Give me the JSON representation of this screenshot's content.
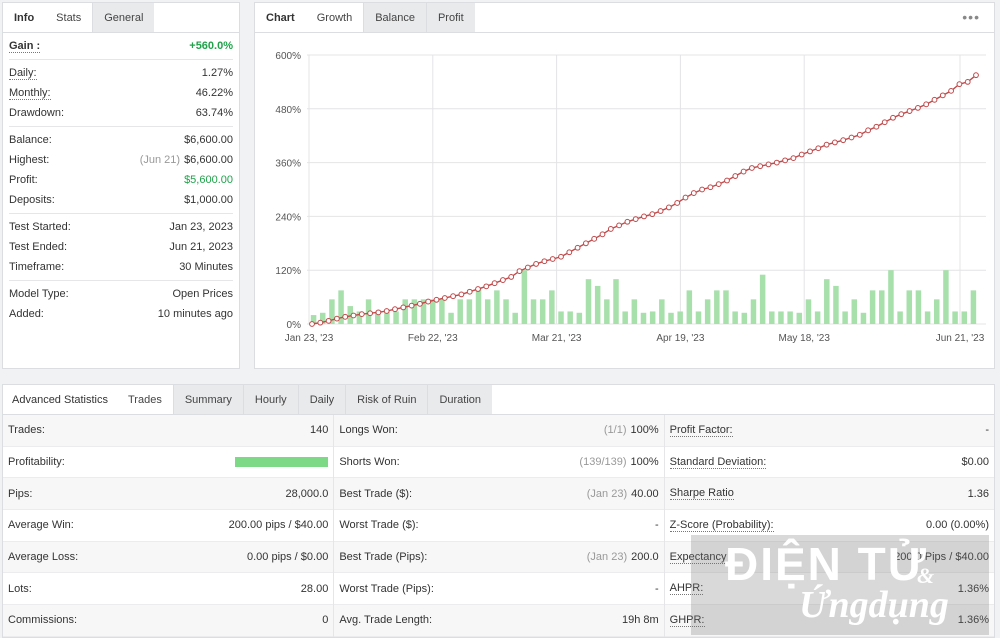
{
  "info": {
    "tabs": [
      "Info",
      "Stats",
      "General"
    ],
    "gain": {
      "label": "Gain :",
      "value": "+560.0%"
    },
    "daily": {
      "label": "Daily:",
      "value": "1.27%"
    },
    "monthly": {
      "label": "Monthly:",
      "value": "46.22%"
    },
    "drawdown": {
      "label": "Drawdown:",
      "value": "63.74%"
    },
    "balance": {
      "label": "Balance:",
      "value": "$6,600.00"
    },
    "highest": {
      "label": "Highest:",
      "date": "(Jun 21)",
      "value": "$6,600.00"
    },
    "profit": {
      "label": "Profit:",
      "value": "$5,600.00"
    },
    "deposits": {
      "label": "Deposits:",
      "value": "$1,000.00"
    },
    "test_started": {
      "label": "Test Started:",
      "value": "Jan 23, 2023"
    },
    "test_ended": {
      "label": "Test Ended:",
      "value": "Jun 21, 2023"
    },
    "timeframe": {
      "label": "Timeframe:",
      "value": "30 Minutes"
    },
    "model_type": {
      "label": "Model Type:",
      "value": "Open Prices"
    },
    "added": {
      "label": "Added:",
      "value": "10 minutes ago"
    }
  },
  "chart_panel": {
    "tabs": [
      "Chart",
      "Growth",
      "Balance",
      "Profit"
    ],
    "menu_icon": "more-dots-icon",
    "menu_glyph": "•••"
  },
  "chart_data": {
    "type": "line",
    "y_ticks": [
      "600%",
      "480%",
      "360%",
      "240%",
      "120%",
      "0%"
    ],
    "y_range": [
      0,
      600
    ],
    "x_tick_labels": [
      "Jan 23, '23",
      "Feb 22, '23",
      "Mar 21, '23",
      "Apr 19, '23",
      "May 18, '23",
      "Jun 21, '23"
    ],
    "grid": true,
    "line_color": "#c0494a",
    "bar_color": "#a8e0ac",
    "growth": [
      0,
      3,
      7,
      12,
      16,
      19,
      22,
      24,
      26,
      29,
      33,
      37,
      41,
      45,
      50,
      54,
      58,
      62,
      66,
      72,
      78,
      84,
      91,
      98,
      105,
      118,
      126,
      134,
      140,
      145,
      150,
      160,
      170,
      180,
      190,
      200,
      212,
      220,
      228,
      234,
      240,
      245,
      252,
      260,
      270,
      282,
      292,
      300,
      305,
      312,
      320,
      330,
      340,
      348,
      352,
      356,
      360,
      365,
      370,
      378,
      385,
      392,
      400,
      405,
      410,
      416,
      422,
      432,
      440,
      450,
      460,
      468,
      475,
      482,
      490,
      500,
      510,
      520,
      535,
      540,
      555
    ],
    "bars": [
      20,
      25,
      55,
      75,
      40,
      28,
      55,
      28,
      28,
      28,
      55,
      55,
      55,
      55,
      55,
      25,
      55,
      55,
      80,
      55,
      75,
      55,
      25,
      120,
      55,
      55,
      75,
      28,
      28,
      25,
      100,
      85,
      55,
      100,
      28,
      55,
      25,
      28,
      55,
      25,
      28,
      75,
      28,
      55,
      75,
      75,
      28,
      25,
      55,
      110,
      28,
      28,
      28,
      25,
      55,
      28,
      100,
      85,
      28,
      55,
      25,
      75,
      75,
      120,
      28,
      75,
      75,
      28,
      55,
      120,
      28,
      28,
      75
    ]
  },
  "advanced": {
    "tabs": [
      "Advanced Statistics",
      "Trades",
      "Summary",
      "Hourly",
      "Daily",
      "Risk of Ruin",
      "Duration"
    ],
    "col1": [
      {
        "label": "Trades:",
        "value": "140"
      },
      {
        "label": "Profitability:",
        "value": ""
      },
      {
        "label": "Pips:",
        "value": "28,000.0"
      },
      {
        "label": "Average Win:",
        "value": "200.00 pips / $40.00"
      },
      {
        "label": "Average Loss:",
        "value": "0.00 pips / $0.00"
      },
      {
        "label": "Lots:",
        "value": "28.00"
      },
      {
        "label": "Commissions:",
        "value": "0"
      }
    ],
    "profitability_pct": 100,
    "col2": [
      {
        "label": "Longs Won:",
        "muted": "(1/1)",
        "value": "100%"
      },
      {
        "label": "Shorts Won:",
        "muted": "(139/139)",
        "value": "100%"
      },
      {
        "label": "Best Trade ($):",
        "muted": "(Jan 23)",
        "value": "40.00"
      },
      {
        "label": "Worst Trade ($):",
        "muted": "",
        "value": "-"
      },
      {
        "label": "Best Trade (Pips):",
        "muted": "(Jan 23)",
        "value": "200.0"
      },
      {
        "label": "Worst Trade (Pips):",
        "muted": "",
        "value": "-"
      },
      {
        "label": "Avg. Trade Length:",
        "muted": "",
        "value": "19h 8m"
      }
    ],
    "col3": [
      {
        "label": "Profit Factor:",
        "value": "-"
      },
      {
        "label": "Standard Deviation:",
        "value": "$0.00"
      },
      {
        "label": "Sharpe Ratio",
        "value": "1.36"
      },
      {
        "label": "Z-Score (Probability):",
        "value": "0.00 (0.00%)"
      },
      {
        "label": "Expectancy",
        "value": "200.0 Pips / $40.00"
      },
      {
        "label": "AHPR:",
        "value": "1.36%"
      },
      {
        "label": "GHPR:",
        "value": "1.36%"
      }
    ]
  },
  "watermark": {
    "line1": "ĐIỆN TỬ",
    "amp": "&",
    "line2": "Ứngdụng"
  }
}
